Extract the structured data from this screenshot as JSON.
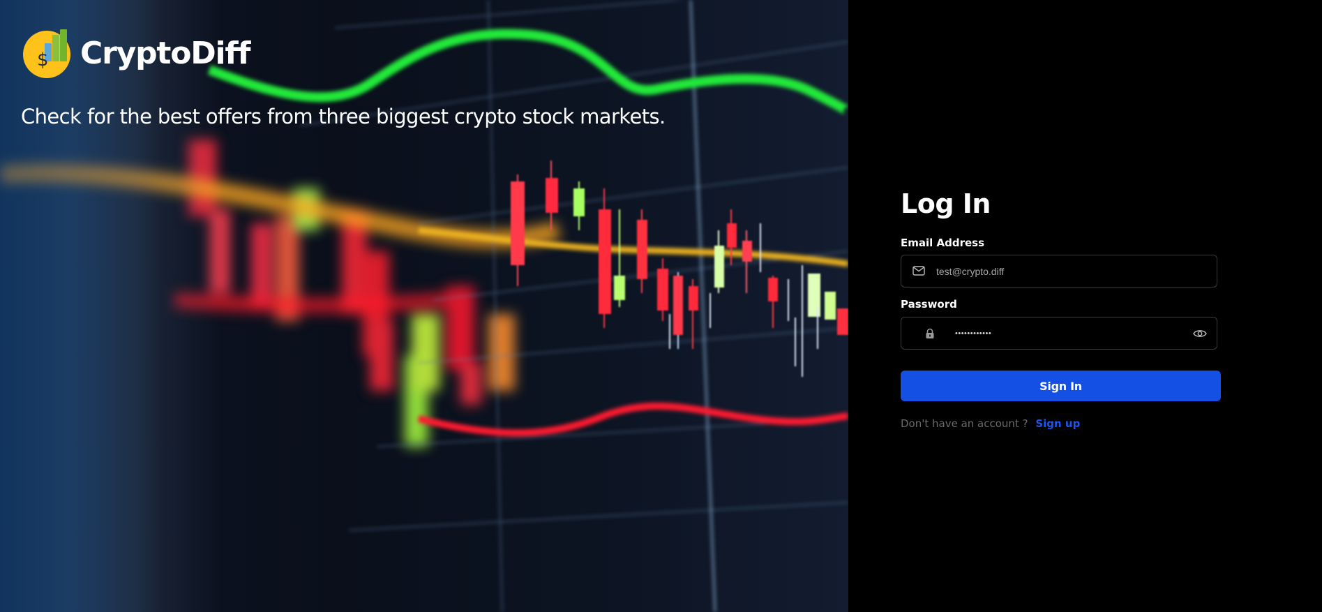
{
  "brand": {
    "name": "CryptoDiff",
    "logo_icon": "dollar-coin-bar-chart-logo",
    "accent": "#FFC21A"
  },
  "hero": {
    "tagline": "Check for the best offers from three biggest crypto stock markets.",
    "background": "blurred-candlestick-chart-photo"
  },
  "login": {
    "title": "Log In",
    "email": {
      "label": "Email Address",
      "placeholder": "test@crypto.diff",
      "value": "",
      "icon": "mail-icon"
    },
    "password": {
      "label": "Password",
      "value": "••••••••••••",
      "icon": "lock-icon",
      "toggle_icon": "eye-icon"
    },
    "submit_label": "Sign In",
    "signup_prompt": "Don't have an account ?",
    "signup_link": "Sign up"
  },
  "colors": {
    "primary": "#1450E3",
    "link": "#1A55F0",
    "panel_bg": "#000000"
  }
}
